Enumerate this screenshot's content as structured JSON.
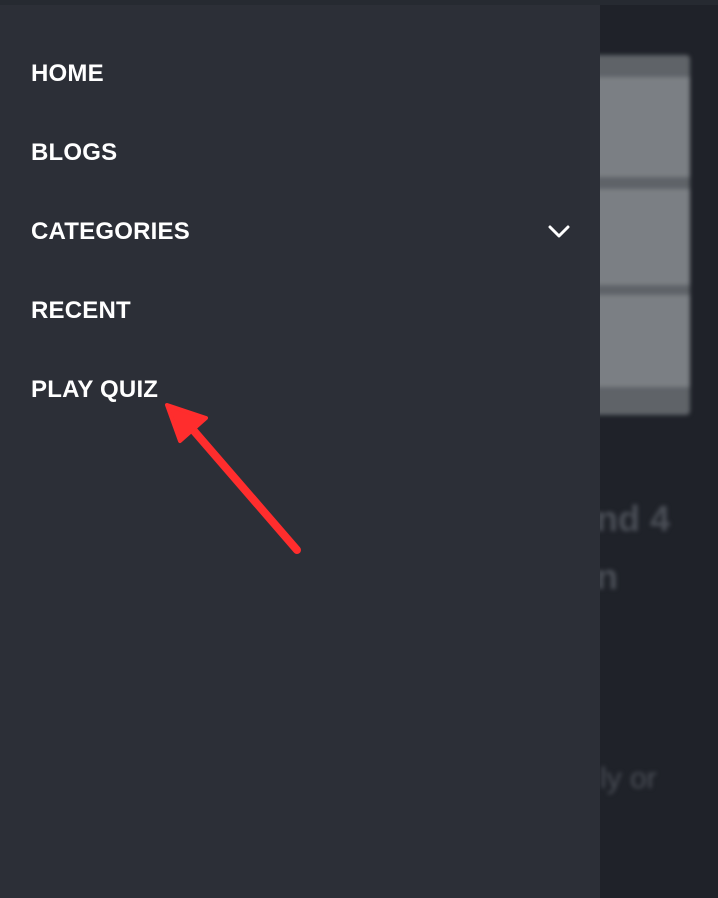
{
  "drawer": {
    "items": [
      {
        "label": "HOME",
        "has_submenu": false
      },
      {
        "label": "BLOGS",
        "has_submenu": false
      },
      {
        "label": "CATEGORIES",
        "has_submenu": true,
        "icon": "chevron-down-icon"
      },
      {
        "label": "RECENT",
        "has_submenu": false
      },
      {
        "label": "PLAY QUIZ",
        "has_submenu": false
      }
    ]
  },
  "background": {
    "partial_text_1": "nd 4",
    "partial_text_2": "n",
    "partial_text_3": "ly or"
  },
  "annotation": {
    "type": "arrow",
    "color": "#ff2d2d",
    "points_to": "PLAY QUIZ"
  },
  "colors": {
    "drawer_bg": "#2c2f37",
    "page_bg": "#1f2229",
    "text": "#ffffff",
    "arrow": "#ff2d2d"
  }
}
